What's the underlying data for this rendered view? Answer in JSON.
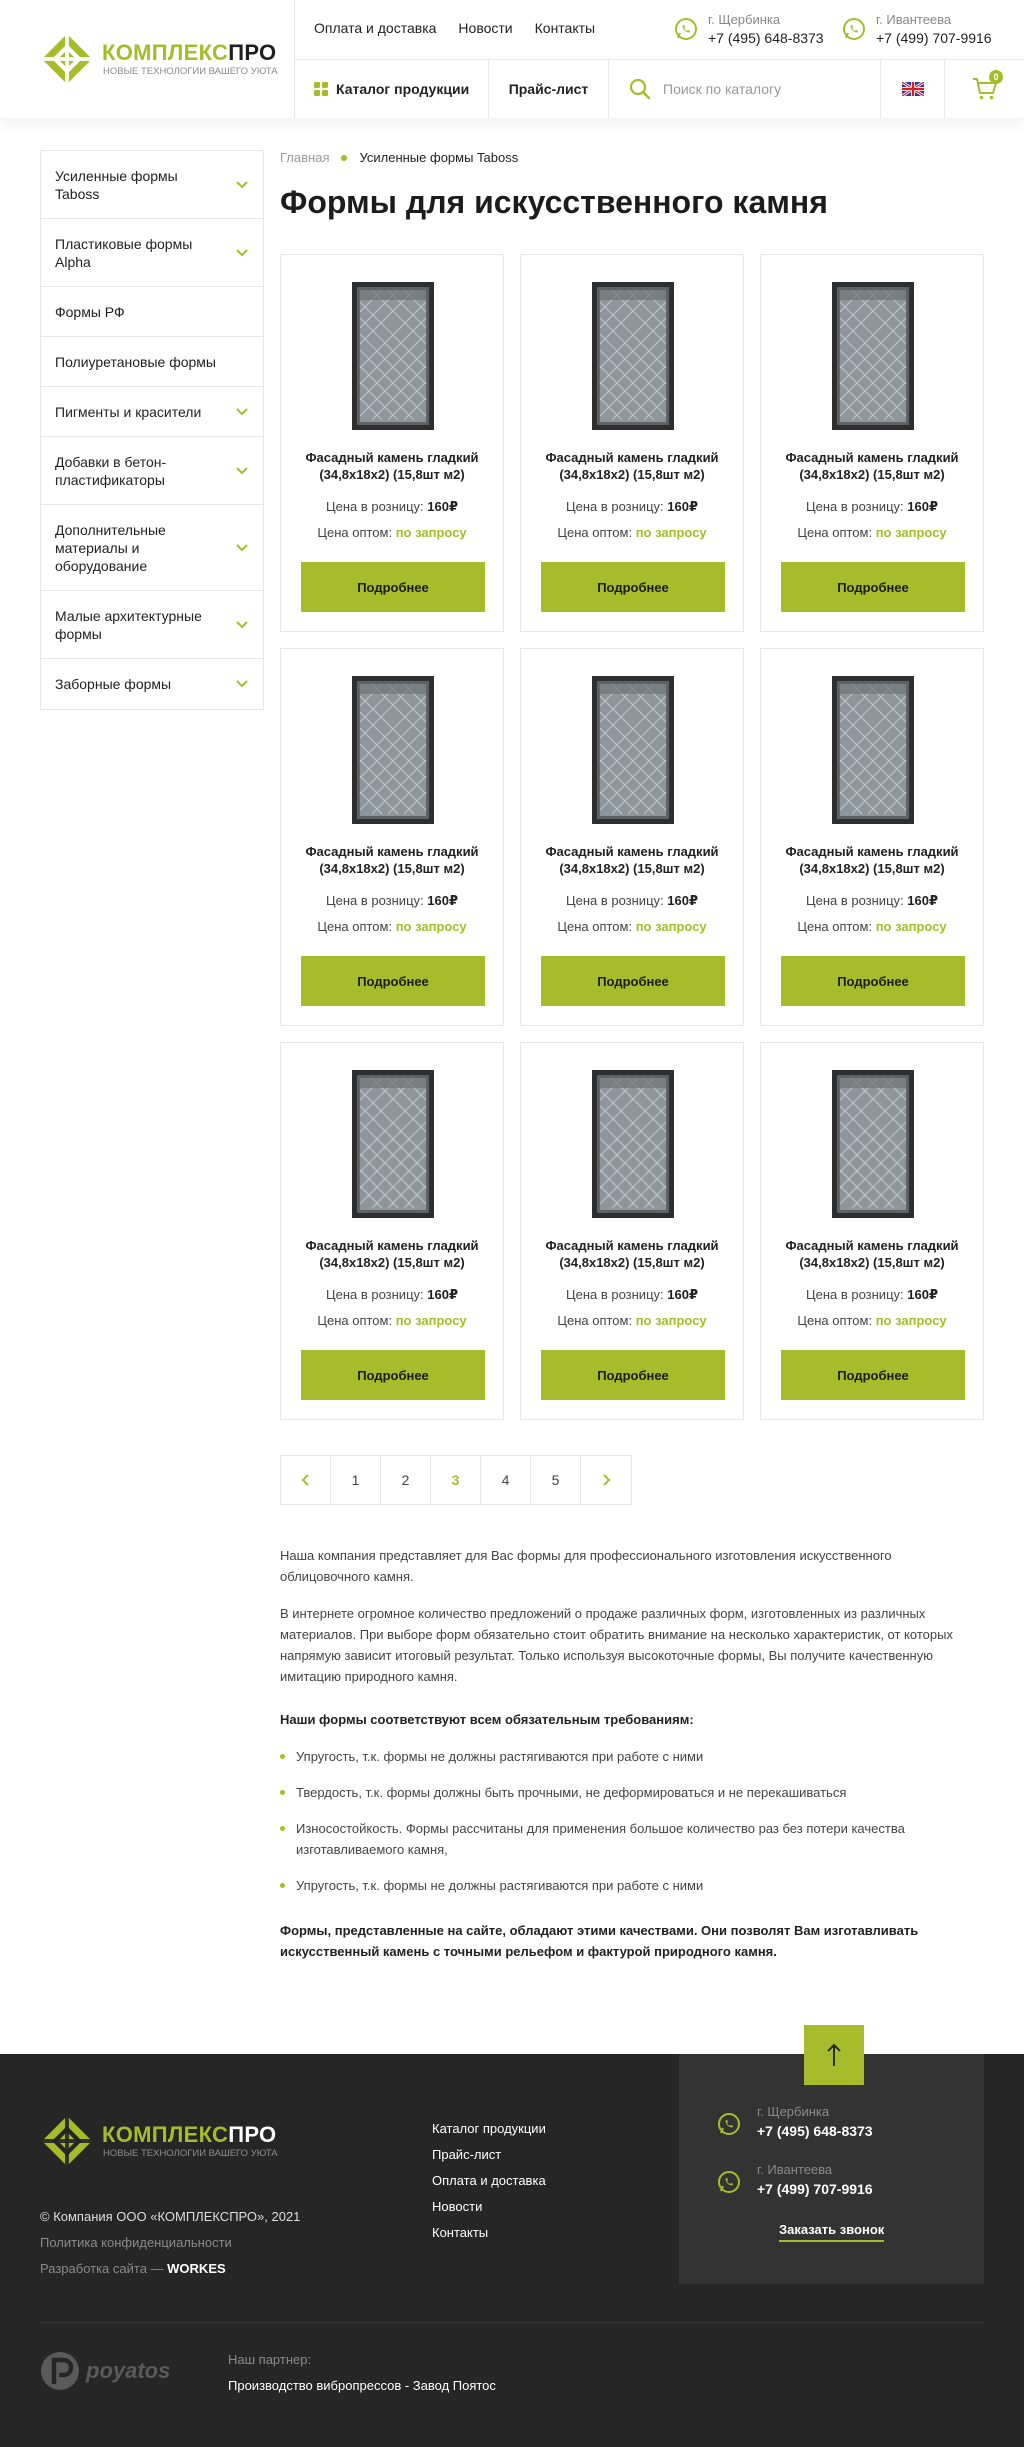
{
  "brand": {
    "name_part1": "КОМПЛЕКС",
    "name_part2": "ПРО",
    "tagline": "НОВЫЕ ТЕХНОЛОГИИ ВАШЕГО УЮТА",
    "accent_color": "#a6bc2b"
  },
  "header": {
    "nav": [
      "Оплата и доставка",
      "Новости",
      "Контакты"
    ],
    "phones": [
      {
        "city": "г. Щербинка",
        "number": "+7 (495) 648-8373"
      },
      {
        "city": "г. Ивантеева",
        "number": "+7 (499) 707-9916"
      }
    ],
    "catalog_label": "Каталог продукции",
    "price_label": "Прайс-лист",
    "search_placeholder": "Поиск по каталогу",
    "cart_count": "0"
  },
  "sidebar": {
    "items": [
      {
        "label": "Усиленные формы Taboss",
        "has_children": true
      },
      {
        "label": "Пластиковые формы Alpha",
        "has_children": true
      },
      {
        "label": "Формы РФ",
        "has_children": false
      },
      {
        "label": "Полиуретановые формы",
        "has_children": false
      },
      {
        "label": "Пигменты и красители",
        "has_children": true
      },
      {
        "label": "Добавки в бетон-пластификаторы",
        "has_children": true
      },
      {
        "label": "Дополнительные материалы и оборудование",
        "has_children": true
      },
      {
        "label": "Малые архитектурные формы",
        "has_children": true
      },
      {
        "label": "Заборные формы",
        "has_children": true
      }
    ]
  },
  "breadcrumb": {
    "home": "Главная",
    "current": "Усиленные формы Taboss"
  },
  "page": {
    "title": "Формы для искусственного камня"
  },
  "products": [
    {
      "name": "Фасадный камень гладкий (34,8х18х2) (15,8шт м2)",
      "retail_label": "Цена в розницу:",
      "retail_price": "160₽",
      "wholesale_label": "Цена оптом:",
      "wholesale_value": "по запросу",
      "button": "Подробнее"
    },
    {
      "name": "Фасадный камень гладкий (34,8х18х2) (15,8шт м2)",
      "retail_label": "Цена в розницу:",
      "retail_price": "160₽",
      "wholesale_label": "Цена оптом:",
      "wholesale_value": "по запросу",
      "button": "Подробнее"
    },
    {
      "name": "Фасадный камень гладкий (34,8х18х2) (15,8шт м2)",
      "retail_label": "Цена в розницу:",
      "retail_price": "160₽",
      "wholesale_label": "Цена оптом:",
      "wholesale_value": "по запросу",
      "button": "Подробнее"
    },
    {
      "name": "Фасадный камень гладкий (34,8х18х2) (15,8шт м2)",
      "retail_label": "Цена в розницу:",
      "retail_price": "160₽",
      "wholesale_label": "Цена оптом:",
      "wholesale_value": "по запросу",
      "button": "Подробнее"
    },
    {
      "name": "Фасадный камень гладкий (34,8х18х2) (15,8шт м2)",
      "retail_label": "Цена в розницу:",
      "retail_price": "160₽",
      "wholesale_label": "Цена оптом:",
      "wholesale_value": "по запросу",
      "button": "Подробнее"
    },
    {
      "name": "Фасадный камень гладкий (34,8х18х2) (15,8шт м2)",
      "retail_label": "Цена в розницу:",
      "retail_price": "160₽",
      "wholesale_label": "Цена оптом:",
      "wholesale_value": "по запросу",
      "button": "Подробнее"
    },
    {
      "name": "Фасадный камень гладкий (34,8х18х2) (15,8шт м2)",
      "retail_label": "Цена в розницу:",
      "retail_price": "160₽",
      "wholesale_label": "Цена оптом:",
      "wholesale_value": "по запросу",
      "button": "Подробнее"
    },
    {
      "name": "Фасадный камень гладкий (34,8х18х2) (15,8шт м2)",
      "retail_label": "Цена в розницу:",
      "retail_price": "160₽",
      "wholesale_label": "Цена оптом:",
      "wholesale_value": "по запросу",
      "button": "Подробнее"
    },
    {
      "name": "Фасадный камень гладкий (34,8х18х2) (15,8шт м2)",
      "retail_label": "Цена в розницу:",
      "retail_price": "160₽",
      "wholesale_label": "Цена оптом:",
      "wholesale_value": "по запросу",
      "button": "Подробнее"
    }
  ],
  "pagination": {
    "pages": [
      "1",
      "2",
      "3",
      "4",
      "5"
    ],
    "current": "3"
  },
  "description": {
    "p1": "Наша компания представляет для Вас формы для профессионального изготовления искусственного облицовочного камня.",
    "p2": "В интернете огромное количество предложений о продаже различных форм, изготовленных из различных материалов. При выборе форм обязательно стоит обратить внимание на несколько характеристик, от которых напрямую зависит итоговый результат. Только используя высокоточные формы, Вы получите качественную имитацию природного камня.",
    "requirements_title": "Наши формы соответствуют всем обязательным требованиям:",
    "requirements": [
      "Упругость, т.к. формы не должны растягиваются при работе с ними",
      "Твердость, т.к. формы должны быть прочными, не деформироваться и не перекашиваться",
      "Износостойкость. Формы рассчитаны для применения большое количество раз без потери качества изготавливаемого камня,",
      "Упругость, т.к. формы не должны растягиваются при работе с ними"
    ],
    "final": "Формы, представленные на сайте, обладают этими качествами. Они позволят Вам изготавливать искусственный камень с точными рельефом и фактурой природного камня."
  },
  "footer": {
    "copyright": "© Компания ООО «КОМПЛЕКСПРО», 2021",
    "privacy": "Политика конфиденциальности",
    "dev_label": "Разработка сайта — ",
    "dev_name": "WORKES",
    "links": [
      "Каталог продукции",
      "Прайс-лист",
      "Оплата и доставка",
      "Новости",
      "Контакты"
    ],
    "phones": [
      {
        "city": "г. Щербинка",
        "number": "+7 (495) 648-8373"
      },
      {
        "city": "г. Ивантеева",
        "number": "+7 (499) 707-9916"
      }
    ],
    "callback_label": "Заказать звонок",
    "partner_label": "Наш партнер:",
    "partner_name": "Производство вибропрессов - Завод Поятос",
    "partner_logo_text": "poyatos"
  }
}
